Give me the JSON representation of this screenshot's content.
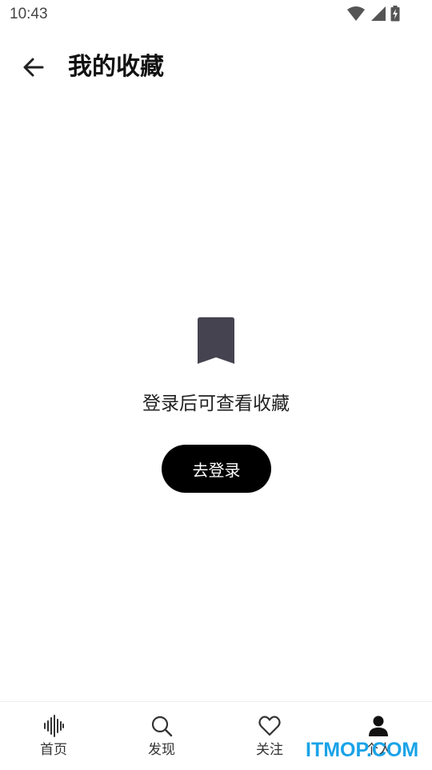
{
  "status_bar": {
    "time": "10:43",
    "icons": [
      "wifi-icon",
      "signal-icon",
      "battery-charging-icon"
    ]
  },
  "header": {
    "title": "我的收藏",
    "back_icon": "arrow-left-icon"
  },
  "empty_state": {
    "icon": "bookmark-icon",
    "message": "登录后可查看收藏",
    "login_button": "去登录",
    "icon_color": "#45434f"
  },
  "bottom_nav": {
    "items": [
      {
        "label": "首页",
        "icon": "sound-wave-icon"
      },
      {
        "label": "发现",
        "icon": "search-icon"
      },
      {
        "label": "关注",
        "icon": "heart-icon"
      },
      {
        "label": "个人",
        "icon": "person-icon",
        "active": true
      }
    ]
  },
  "watermark": "ITMOP.COM",
  "colors": {
    "primary": "#000000",
    "watermark": "#1aa3e8"
  }
}
